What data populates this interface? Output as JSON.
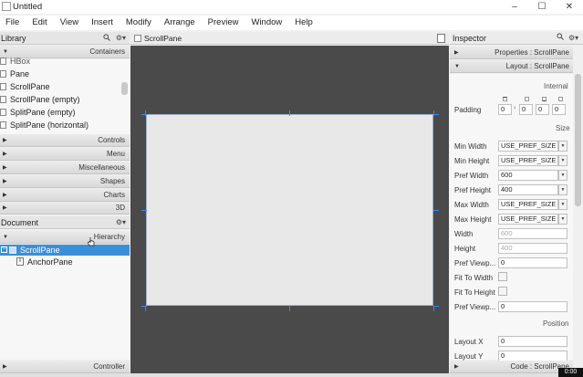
{
  "window": {
    "title": "Untitled",
    "minimize": "–",
    "maximize": "☐",
    "close": "✕"
  },
  "menu": [
    "File",
    "Edit",
    "View",
    "Insert",
    "Modify",
    "Arrange",
    "Preview",
    "Window",
    "Help"
  ],
  "library": {
    "title": "Library",
    "containers_label": "Containers",
    "items": [
      "HBox",
      "Pane",
      "ScrollPane",
      "ScrollPane  (empty)",
      "SplitPane  (empty)",
      "SplitPane  (horizontal)"
    ],
    "sections": [
      "Controls",
      "Menu",
      "Miscellaneous",
      "Shapes",
      "Charts",
      "3D"
    ]
  },
  "document": {
    "title": "Document",
    "hierarchy_label": "Hierarchy",
    "tree": [
      "ScrollPane",
      "AnchorPane"
    ],
    "controller_label": "Controller"
  },
  "center": {
    "breadcrumb": "ScrollPane"
  },
  "inspector": {
    "title": "Inspector",
    "properties_label": "Properties : ScrollPane",
    "layout_label": "Layout : ScrollPane",
    "code_label": "Code : ScrollPane",
    "internal_label": "Internal",
    "size_label": "Size",
    "position_label": "Position",
    "padding": {
      "label": "Padding",
      "values": [
        "0",
        "0",
        "0",
        "0"
      ]
    },
    "size_props": [
      {
        "label": "Min Width",
        "value": "USE_PREF_SIZE",
        "type": "dropdown"
      },
      {
        "label": "Min Height",
        "value": "USE_PREF_SIZE",
        "type": "dropdown"
      },
      {
        "label": "Pref Width",
        "value": "600",
        "type": "dropdown"
      },
      {
        "label": "Pref Height",
        "value": "400",
        "type": "dropdown"
      },
      {
        "label": "Max Width",
        "value": "USE_PREF_SIZE",
        "type": "dropdown"
      },
      {
        "label": "Max Height",
        "value": "USE_PREF_SIZE",
        "type": "dropdown"
      },
      {
        "label": "Width",
        "value": "600",
        "type": "disabled"
      },
      {
        "label": "Height",
        "value": "400",
        "type": "disabled"
      },
      {
        "label": "Pref Viewp...",
        "value": "0",
        "type": "text"
      },
      {
        "label": "Fit To Width",
        "value": "",
        "type": "check"
      },
      {
        "label": "Fit To Height",
        "value": "",
        "type": "check"
      },
      {
        "label": "Pref Viewp...",
        "value": "0",
        "type": "text"
      }
    ],
    "position_props": [
      {
        "label": "Layout X",
        "value": "0"
      },
      {
        "label": "Layout Y",
        "value": "0"
      }
    ]
  },
  "status": {
    "time": "0:00"
  },
  "colors": {
    "selection": "#3b8fd8",
    "canvas": "#4a4a4a",
    "handle": "#2f8cff"
  }
}
